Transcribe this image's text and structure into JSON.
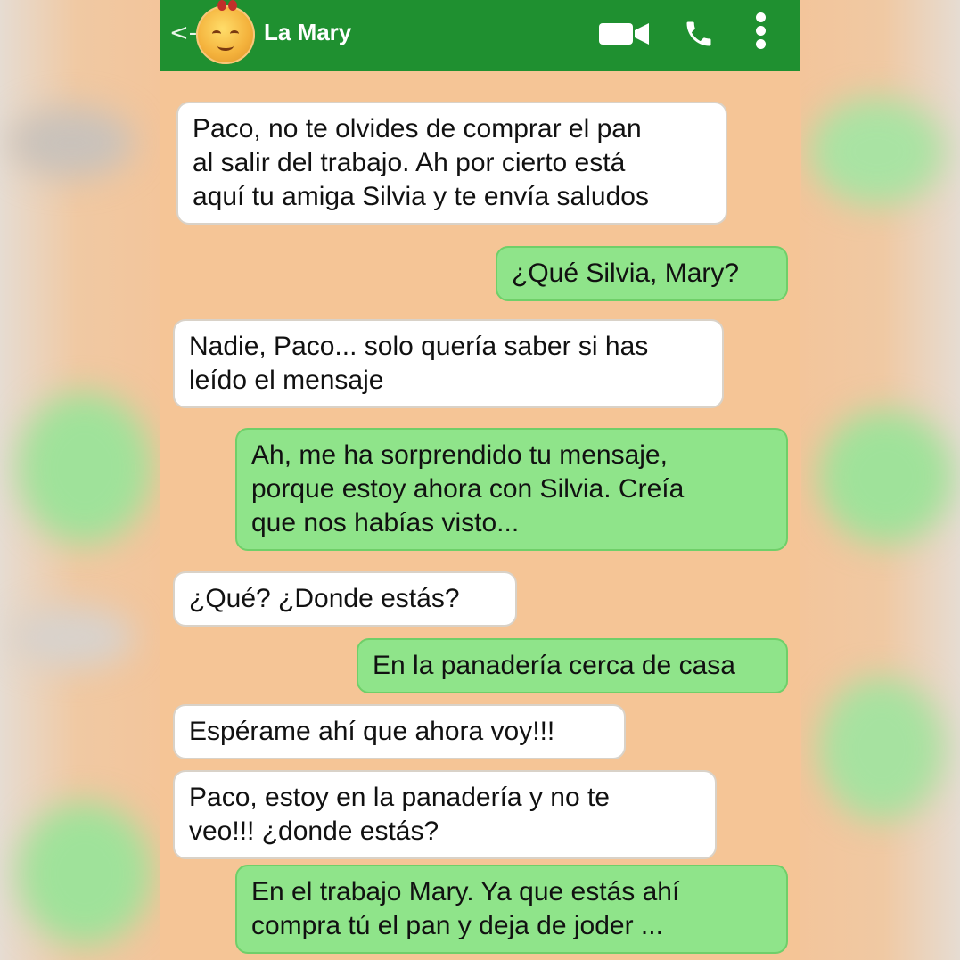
{
  "header": {
    "contact_name": "La Mary",
    "background": "#1f9030",
    "back_glyph": "<-"
  },
  "chat": {
    "background": "#f5c596",
    "incoming_color": "#ffffff",
    "outgoing_color": "#8fe48a",
    "messages": [
      {
        "from": "contact",
        "text": "Paco, no te olvides de comprar el pan\nal salir del trabajo. Ah por cierto está\naquí tu amiga Silvia y te envía saludos"
      },
      {
        "from": "me",
        "text": "¿Qué Silvia, Mary?"
      },
      {
        "from": "contact",
        "text": "Nadie, Paco... solo quería saber si has\nleído el mensaje"
      },
      {
        "from": "me",
        "text": "Ah, me ha sorprendido tu mensaje,\nporque estoy ahora con Silvia. Creía\nque nos habías visto..."
      },
      {
        "from": "contact",
        "text": "¿Qué? ¿Donde estás?"
      },
      {
        "from": "me",
        "text": "En la panadería cerca de casa"
      },
      {
        "from": "contact",
        "text": "Espérame ahí que ahora voy!!!"
      },
      {
        "from": "contact",
        "text": "Paco, estoy en la panadería y no te\nveo!!! ¿donde estás?"
      },
      {
        "from": "me",
        "text": "En el trabajo Mary. Ya que estás ahí\ncompra tú el pan y deja de joder ..."
      }
    ]
  },
  "icons": [
    "back-arrow-icon",
    "avatar",
    "video-call-icon",
    "phone-call-icon",
    "more-options-icon"
  ]
}
